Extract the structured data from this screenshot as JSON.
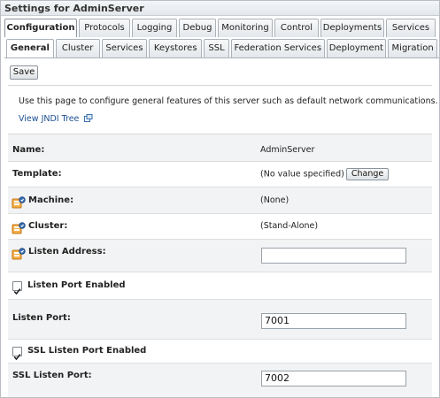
{
  "window": {
    "title": "Settings for AdminServer"
  },
  "tabs": {
    "primary": [
      "Configuration",
      "Protocols",
      "Logging",
      "Debug",
      "Monitoring",
      "Control",
      "Deployments",
      "Services"
    ],
    "secondary": [
      "General",
      "Cluster",
      "Services",
      "Keystores",
      "SSL",
      "Federation Services",
      "Deployment",
      "Migration"
    ]
  },
  "toolbar": {
    "save_label": "Save"
  },
  "description": "Use this page to configure general features of this server such as default network communications.",
  "links": {
    "jndi": "View JNDI Tree"
  },
  "fields": {
    "name": {
      "label": "Name:",
      "value": "AdminServer"
    },
    "template": {
      "label": "Template:",
      "value": "(No value specified)",
      "button": "Change"
    },
    "machine": {
      "label": "Machine:",
      "value": "(None)"
    },
    "cluster": {
      "label": "Cluster:",
      "value": "(Stand-Alone)"
    },
    "listen_address": {
      "label": "Listen Address:",
      "value": ""
    },
    "listen_port_enabled": {
      "label": "Listen Port Enabled",
      "checked": true
    },
    "listen_port": {
      "label": "Listen Port:",
      "value": "7001"
    },
    "ssl_listen_port_enabled": {
      "label": "SSL Listen Port Enabled",
      "checked": true
    },
    "ssl_listen_port": {
      "label": "SSL Listen Port:",
      "value": "7002"
    }
  },
  "icons": {
    "restart": "restart-required-icon",
    "link": "external-link-icon",
    "check": "checkmark-icon"
  },
  "colors": {
    "link": "#1d4f91",
    "shade": "#f2f3f4",
    "icon_orange": "#e08a1e",
    "icon_blue": "#3a6fb0"
  }
}
